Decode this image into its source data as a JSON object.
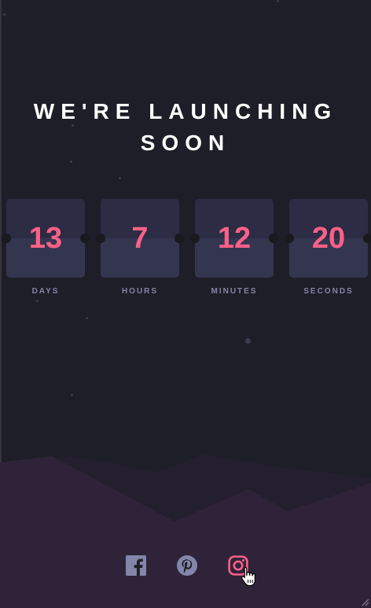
{
  "heading": "WE'RE LAUNCHING SOON",
  "countdown": [
    {
      "value": "13",
      "label": "DAYS"
    },
    {
      "value": "7",
      "label": "HOURS"
    },
    {
      "value": "12",
      "label": "MINUTES"
    },
    {
      "value": "20",
      "label": "SECONDS"
    }
  ],
  "social": [
    {
      "name": "facebook-icon",
      "color": "#8385a9"
    },
    {
      "name": "pinterest-icon",
      "color": "#8385a9"
    },
    {
      "name": "instagram-icon",
      "color": "#fb6087"
    }
  ],
  "colors": {
    "background": "#1e1e28",
    "accent": "#fb6087",
    "card": "#343650",
    "label": "#8385a9"
  }
}
